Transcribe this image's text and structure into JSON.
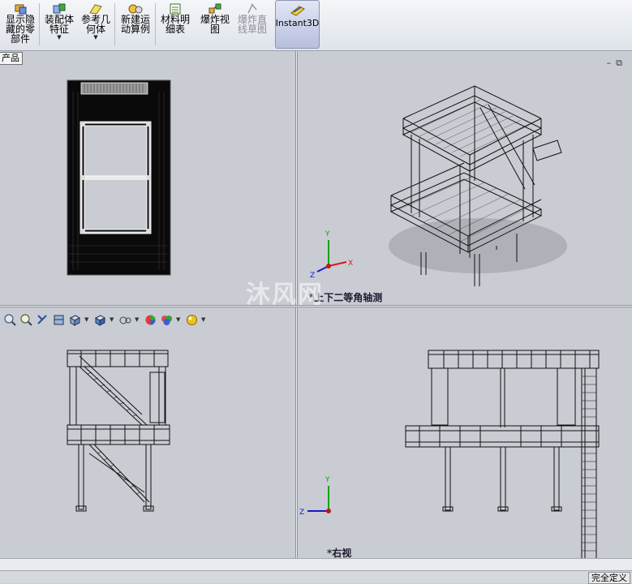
{
  "toolbar": {
    "buttons": [
      {
        "label": "显示隐\n藏的零\n部件",
        "icon": "show-hidden-components-icon"
      },
      {
        "label": "装配体\n特征",
        "icon": "assembly-features-icon",
        "dropdown": true
      },
      {
        "label": "参考几\n何体",
        "icon": "reference-geometry-icon",
        "dropdown": true
      },
      {
        "label": "新建运\n动算例",
        "icon": "new-motion-study-icon"
      },
      {
        "label": "材料明\n细表",
        "icon": "bill-of-materials-icon"
      },
      {
        "label": "爆炸视\n图",
        "icon": "exploded-view-icon"
      },
      {
        "label": "爆炸直\n线草图",
        "icon": "explode-line-sketch-icon",
        "disabled": true
      }
    ],
    "instant3d": {
      "label": "Instant3D",
      "icon": "instant3d-icon"
    }
  },
  "viewports": {
    "top_left": {
      "tree_tab": "产品"
    },
    "top_right": {
      "label": "*上下二等角轴测"
    },
    "bottom_right": {
      "label": "*右视"
    }
  },
  "watermark": "沐风网",
  "status_bar": {
    "right_text": "完全定义"
  },
  "colors": {
    "axis_x": "#d81818",
    "axis_y": "#18a018",
    "axis_z": "#1818c8",
    "background": "#c9ccd3"
  }
}
